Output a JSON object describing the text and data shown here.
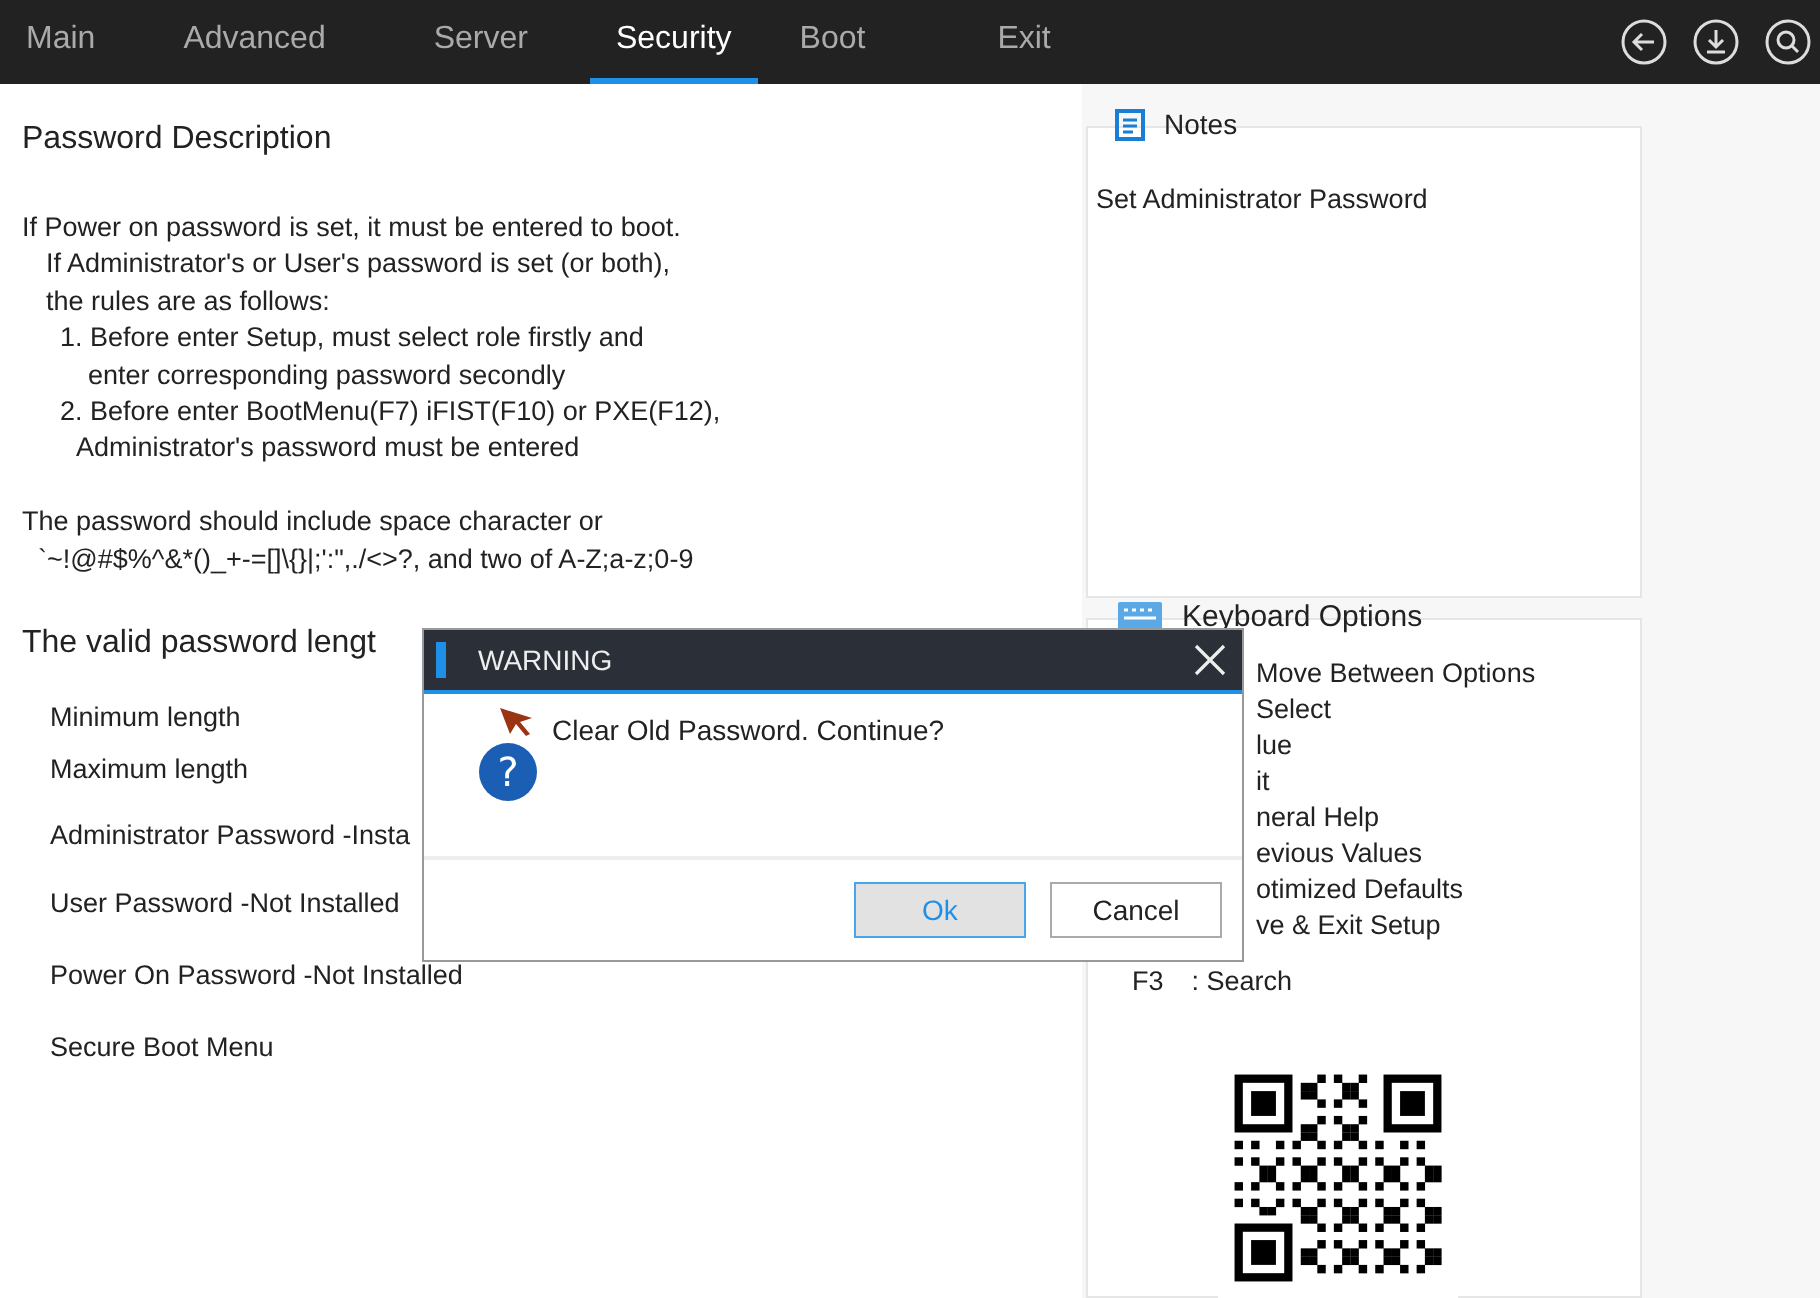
{
  "tabs": [
    {
      "label": "Main",
      "selected": false
    },
    {
      "label": "Advanced",
      "selected": false
    },
    {
      "label": "Server",
      "selected": false
    },
    {
      "label": "Security",
      "selected": true
    },
    {
      "label": "Boot",
      "selected": false
    },
    {
      "label": "Exit",
      "selected": false
    }
  ],
  "description": {
    "title": "Password Description",
    "lines": [
      {
        "kind": "l0",
        "text": "If Power on password is set, it must be entered to boot."
      },
      {
        "kind": "l1",
        "text": "If Administrator's or User's password is set (or both),"
      },
      {
        "kind": "l1",
        "text": "the rules are as follows:"
      },
      {
        "kind": "l2",
        "text": "1. Before enter Setup, must select role firstly and"
      },
      {
        "kind": "l4",
        "text": "enter corresponding password secondly"
      },
      {
        "kind": "l2",
        "text": "2. Before enter BootMenu(F7) iFIST(F10) or PXE(F12),"
      },
      {
        "kind": "l3",
        "text": "Administrator's password must be entered"
      },
      {
        "kind": "gap"
      },
      {
        "kind": "l0",
        "text": "The password should include space character or"
      },
      {
        "kind": "l5",
        "text": "`~!@#$%^&*()_+-=[]\\{}|;':\",./<>?, and two of A-Z;a-z;0-9"
      }
    ]
  },
  "length_title": "The valid password lengt",
  "settings": [
    {
      "label": "Minimum length"
    },
    {
      "label": "Maximum length"
    },
    {
      "label": "Administrator Password -Insta"
    },
    {
      "label": "User Password -Not Installed"
    },
    {
      "label": "Power On Password -Not Installed"
    },
    {
      "label": "Secure Boot Menu"
    }
  ],
  "notes": {
    "title": "Notes",
    "text": "Set Administrator Password"
  },
  "keyboard": {
    "title": "Keyboard Options",
    "items": [
      {
        "text": "Move Between Options"
      },
      {
        "text": "Select"
      },
      {
        "text": "lue"
      },
      {
        "text": "it"
      },
      {
        "text": "neral Help"
      },
      {
        "text": "evious Values"
      },
      {
        "text": "otimized Defaults"
      },
      {
        "text": "ve & Exit Setup"
      },
      {
        "key": "F3",
        "text": ": Search"
      }
    ]
  },
  "dialog": {
    "title": "WARNING",
    "icon_text": "?",
    "message": "Clear Old Password. Continue?",
    "buttons": [
      {
        "label": "Ok",
        "selected": true
      },
      {
        "label": "Cancel",
        "selected": false
      }
    ]
  }
}
